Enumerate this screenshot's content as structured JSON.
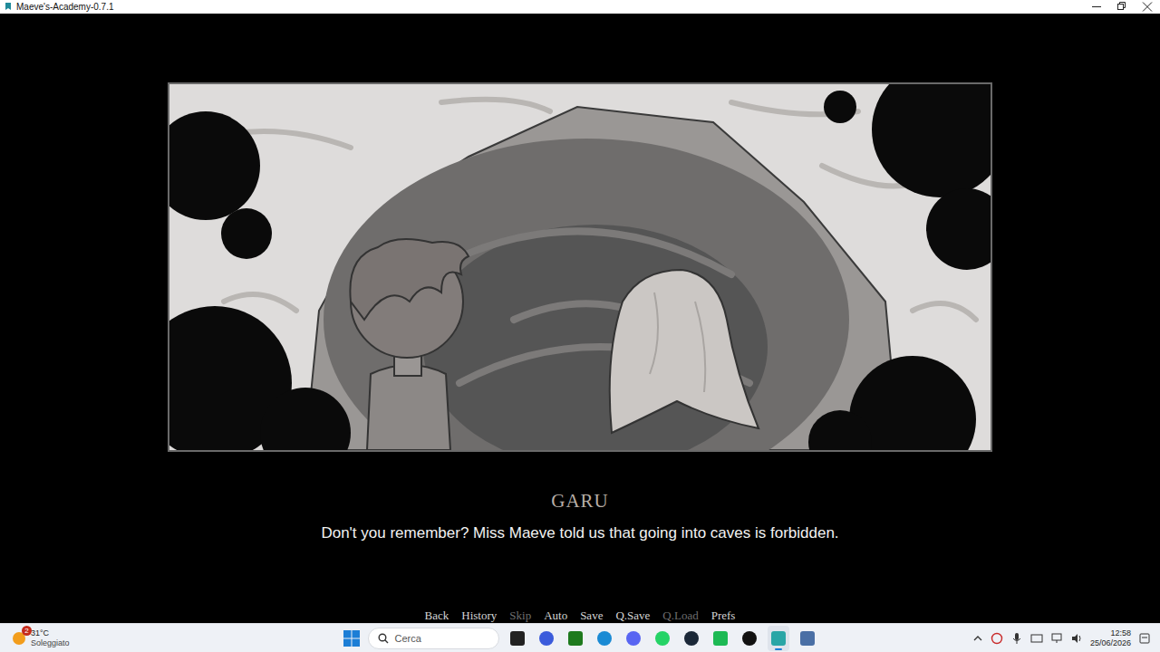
{
  "window": {
    "title": "Maeve's-Academy-0.7.1"
  },
  "scene": {
    "speaker": "GARU",
    "dialogue": "Don't you remember? Miss Maeve told us that going into caves is forbidden."
  },
  "quick_menu": [
    {
      "label": "Back",
      "disabled": false
    },
    {
      "label": "History",
      "disabled": false
    },
    {
      "label": "Skip",
      "disabled": true
    },
    {
      "label": "Auto",
      "disabled": false
    },
    {
      "label": "Save",
      "disabled": false
    },
    {
      "label": "Q.Save",
      "disabled": false
    },
    {
      "label": "Q.Load",
      "disabled": true
    },
    {
      "label": "Prefs",
      "disabled": false
    }
  ],
  "taskbar": {
    "weather": {
      "temperature": "31°C",
      "condition": "Soleggiato",
      "badge": "2"
    },
    "search": {
      "placeholder": "Cerca"
    },
    "apps": [
      {
        "running": false,
        "selected": false
      },
      {
        "running": false,
        "selected": false
      },
      {
        "running": false,
        "selected": false
      },
      {
        "running": false,
        "selected": false
      },
      {
        "running": false,
        "selected": false
      },
      {
        "running": false,
        "selected": false
      },
      {
        "running": false,
        "selected": false
      },
      {
        "running": false,
        "selected": false
      },
      {
        "running": false,
        "selected": false
      },
      {
        "running": true,
        "selected": true
      },
      {
        "running": false,
        "selected": false
      }
    ],
    "clock": {
      "time": "12:58",
      "date": "25/06/2026"
    }
  }
}
